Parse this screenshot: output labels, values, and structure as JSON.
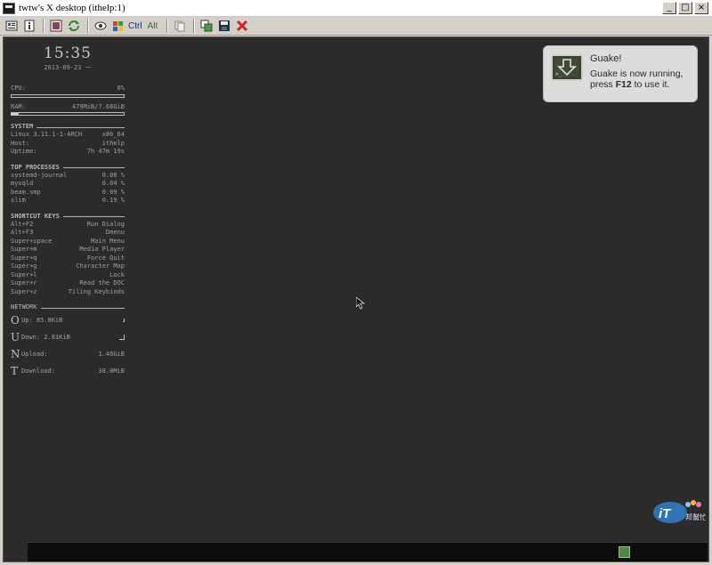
{
  "window": {
    "title": "twtw's X desktop (ithelp:1)",
    "minimize_glyph": "_",
    "maximize_glyph": "□",
    "close_glyph": "×"
  },
  "toolbar": {
    "ctrl_label": "Ctrl",
    "alt_label": "Alt"
  },
  "conky": {
    "time": "15:35",
    "date": "2013-09-23 一",
    "cpu": {
      "label": "CPU:",
      "value": "0%",
      "percent": 0
    },
    "ram": {
      "label": "RAM:",
      "value": "479MiB/7.68GiB",
      "percent": 6
    },
    "system": {
      "title": "SYSTEM",
      "rows": [
        {
          "left": "Linux 3.11.1-1-ARCH",
          "right": "x86_64"
        },
        {
          "left": "Host:",
          "right": "ithelp"
        },
        {
          "left": "Uptime:",
          "right": "7h 47m 19s"
        }
      ]
    },
    "top_processes": {
      "title": "TOP PROCESSES",
      "rows": [
        {
          "left": "systemd-journal",
          "right": "0.08 %"
        },
        {
          "left": "mysqld",
          "right": "0.04 %"
        },
        {
          "left": "beam.smp",
          "right": "0.09 %"
        },
        {
          "left": "slim",
          "right": "0.19 %"
        }
      ]
    },
    "shortcut_keys": {
      "title": "SHORTCUT KEYS",
      "rows": [
        {
          "left": "Alt+F2",
          "right": "Run Dialog"
        },
        {
          "left": "Alt+F3",
          "right": "Dmenu"
        },
        {
          "left": "Super+space",
          "right": "Main Menu"
        },
        {
          "left": "Super+m",
          "right": "Media Player"
        },
        {
          "left": "Super+q",
          "right": "Force Quit"
        },
        {
          "left": "Super+g",
          "right": "Character Map"
        },
        {
          "left": "Super+l",
          "right": "Lock"
        },
        {
          "left": "Super+r",
          "right": "Read the DOC"
        },
        {
          "left": "Super+z",
          "right": "Tiling Keybinds"
        }
      ]
    },
    "network": {
      "title": "NETWORK",
      "rows": [
        {
          "glyph": "O",
          "label": "Up: 85.8KiB",
          "value": ""
        },
        {
          "glyph": "U",
          "label": "Down: 2.81KiB",
          "value": ""
        },
        {
          "glyph": "N",
          "label": "Upload:",
          "value": "1.46GiB"
        },
        {
          "glyph": "T",
          "label": "Download:",
          "value": "38.0MiB"
        }
      ]
    }
  },
  "notification": {
    "title": "Guake!",
    "message_pre": "Guake is now running,",
    "message_mid": "press ",
    "message_key": "F12",
    "message_post": " to use it.",
    "icon": "guake-terminal-icon"
  },
  "watermark": {
    "text": "iT",
    "subtext": "邦幫忙"
  },
  "colors": {
    "desktop_bg": "#2b2b2b",
    "panel_bg": "#0d0d0d",
    "notification_bg": "#dcdcda"
  }
}
